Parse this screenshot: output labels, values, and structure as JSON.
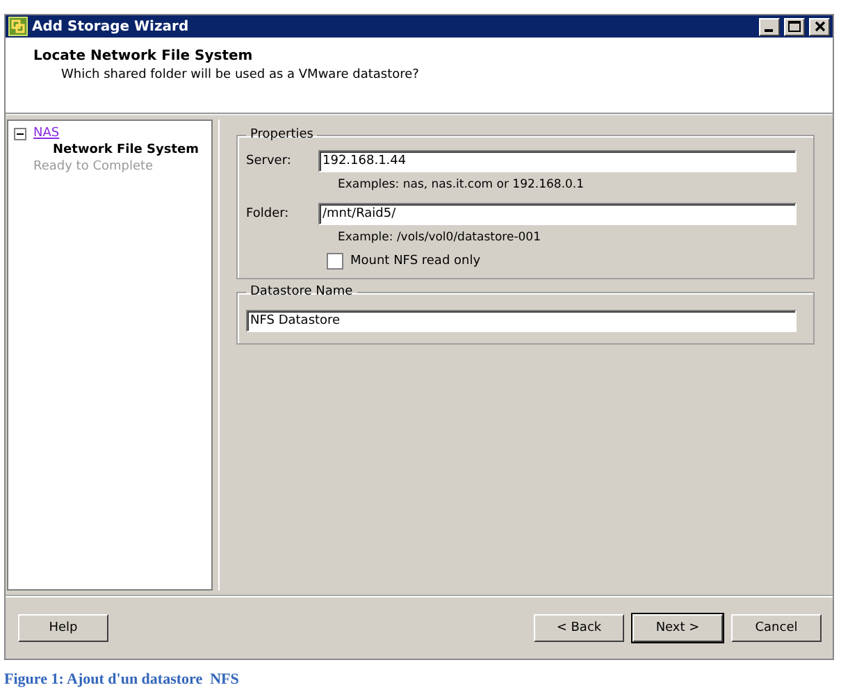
{
  "window": {
    "title": "Add Storage Wizard"
  },
  "header": {
    "title": "Locate Network File System",
    "subtitle": "Which shared folder will be used as a VMware datastore?"
  },
  "steps": [
    {
      "label": "NAS",
      "kind": "visited",
      "expanded": true,
      "children": [
        {
          "label": "Network File System",
          "kind": "current"
        }
      ]
    },
    {
      "label": "Ready to Complete",
      "kind": "pending"
    }
  ],
  "properties": {
    "title": "Properties",
    "server": {
      "label": "Server:",
      "value": "192.168.1.44",
      "hint": "Examples: nas, nas.it.com or 192.168.0.1"
    },
    "folder": {
      "label": "Folder:",
      "value": "/mnt/Raid5/",
      "hint": "Example: /vols/vol0/datastore-001"
    },
    "read_only": {
      "label": "Mount NFS read only",
      "checked": false
    }
  },
  "datastore": {
    "title": "Datastore Name",
    "value": "NFS Datastore"
  },
  "buttons": {
    "help": "Help",
    "back": "< Back",
    "next": "Next >",
    "cancel": "Cancel"
  },
  "caption": "Figure 1: Ajout d'un datastore  NFS"
}
